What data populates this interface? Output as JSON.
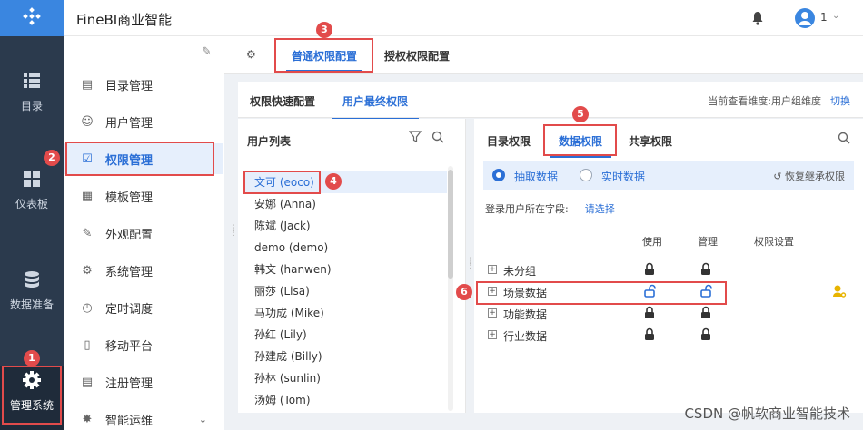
{
  "app": {
    "title": "FineBI商业智能",
    "user": "1"
  },
  "rail": {
    "items": [
      {
        "label": "目录",
        "icon": "list-icon"
      },
      {
        "label": "仪表板",
        "icon": "dashboard-icon"
      },
      {
        "label": "数据准备",
        "icon": "database-icon"
      },
      {
        "label": "管理系统",
        "icon": "gear-icon"
      }
    ]
  },
  "menu": {
    "items": [
      {
        "label": "目录管理",
        "icon": "book-icon"
      },
      {
        "label": "用户管理",
        "icon": "user-icon"
      },
      {
        "label": "权限管理",
        "icon": "lock-icon"
      },
      {
        "label": "模板管理",
        "icon": "template-icon"
      },
      {
        "label": "外观配置",
        "icon": "brush-icon"
      },
      {
        "label": "系统管理",
        "icon": "gear-icon"
      },
      {
        "label": "定时调度",
        "icon": "clock-icon"
      },
      {
        "label": "移动平台",
        "icon": "mobile-icon"
      },
      {
        "label": "注册管理",
        "icon": "register-icon"
      },
      {
        "label": "智能运维",
        "icon": "ops-icon"
      }
    ]
  },
  "tabs1": {
    "general": "普通权限配置",
    "grant": "授权权限配置"
  },
  "tabs2": {
    "quick": "权限快速配置",
    "final": "用户最终权限",
    "view_dim": "当前查看维度:用户组维度",
    "switch": "切换"
  },
  "userlist": {
    "header": "用户列表",
    "users": [
      "文可 (eoco)",
      "安娜 (Anna)",
      "陈斌 (Jack)",
      "demo (demo)",
      "韩文 (hanwen)",
      "丽莎 (Lisa)",
      "马功成 (Mike)",
      "孙红 (Lily)",
      "孙建成 (Billy)",
      "孙林 (sunlin)",
      "汤姆 (Tom)"
    ]
  },
  "perm": {
    "tabs": [
      "目录权限",
      "数据权限",
      "共享权限"
    ],
    "modes": {
      "extract": "抽取数据",
      "realtime": "实时数据",
      "restore": "恢复继承权限"
    },
    "field_label": "登录用户所在字段:",
    "field_pick": "请选择",
    "cols": {
      "use": "使用",
      "manage": "管理",
      "setting": "权限设置"
    },
    "rows": [
      "未分组",
      "场景数据",
      "功能数据",
      "行业数据"
    ]
  },
  "badges": [
    "1",
    "2",
    "3",
    "4",
    "5",
    "6"
  ],
  "watermark": "CSDN @帆软商业智能技术",
  "colors": {
    "accent": "#2b6fd6",
    "rail": "#2b3a4d",
    "annotation": "#e24b4b"
  }
}
